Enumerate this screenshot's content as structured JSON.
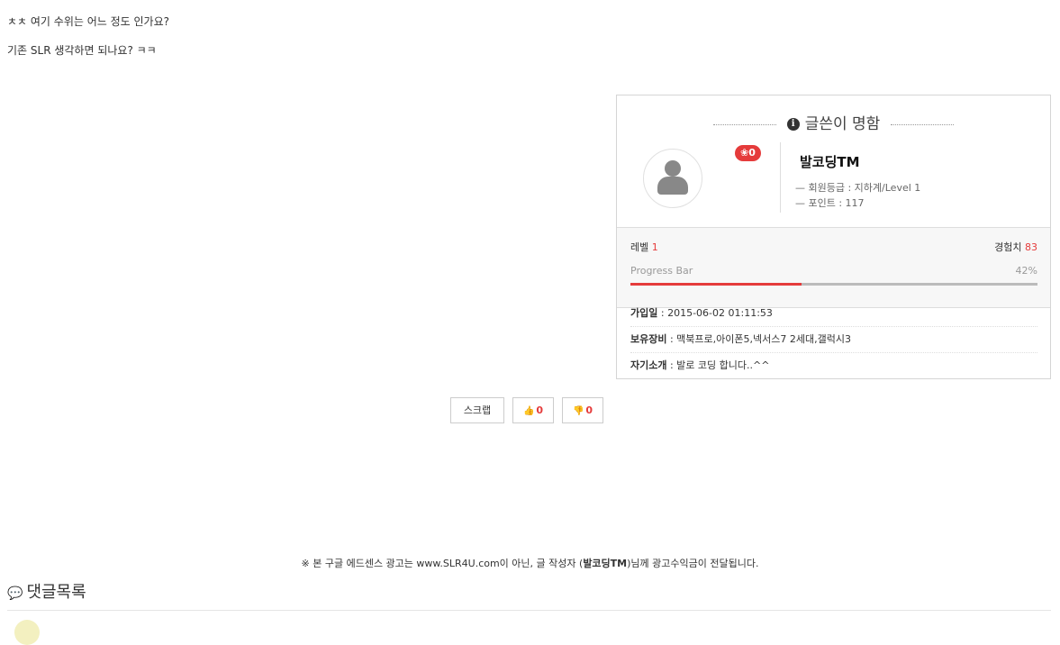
{
  "post": {
    "line1": "ㅊㅊ 여기 수위는 어느 정도 인가요?",
    "line2": "기존 SLR 생각하면 되나요? ㅋㅋ"
  },
  "card": {
    "title": "글쓴이 명함",
    "memo_count": "0",
    "nickname": "발코딩TM",
    "grade": "— 회원등급 : 지하계/Level 1",
    "points": "— 포인트 : 117",
    "level_label": "레벨",
    "level_value": "1",
    "exp_label": "경험치",
    "exp_value": "83",
    "progress_label": "Progress Bar",
    "progress_pct_text": "42%",
    "progress_value": 42,
    "join_label": "가입일",
    "join_value": " : 2015-06-02 01:11:53",
    "equip_label": "보유장비",
    "equip_value": " : 맥북프로,아이폰5,넥서스7 2세대,갤럭시3",
    "intro_label": "자기소개",
    "intro_value": " : 발로 코딩 합니다..^^"
  },
  "actions": {
    "scrap": "스크랩",
    "good_count": "0",
    "bad_count": "0"
  },
  "ad_note": {
    "prefix": "※ 본 구글 에드센스 광고는 www.SLR4U.com이 아닌, 글 작성자 (",
    "author": "발코딩TM",
    "suffix": ")님께 광고수익금이 전달됩니다."
  },
  "comments": {
    "heading": "댓글목록"
  },
  "colors": {
    "accent": "#e53b3b"
  }
}
